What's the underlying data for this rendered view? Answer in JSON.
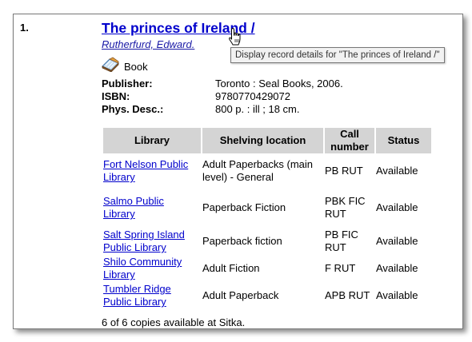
{
  "record": {
    "number": "1.",
    "title": "The princes of Ireland /",
    "author": "Rutherfurd, Edward.",
    "tooltip": "Display record details for \"The princes of Ireland /\"",
    "format_icon": "book-icon",
    "format": "Book",
    "details": [
      {
        "label": "Publisher:",
        "value": "Toronto : Seal Books, 2006."
      },
      {
        "label": "ISBN:",
        "value": "9780770429072"
      },
      {
        "label": "Phys. Desc.:",
        "value": "800 p. : ill ; 18 cm."
      }
    ]
  },
  "holdings": {
    "columns": [
      "Library",
      "Shelving location",
      "Call number",
      "Status"
    ],
    "rows": [
      {
        "library": "Fort Nelson Public Library",
        "location": "Adult Paperbacks (main level) - General",
        "call_number": "PB RUT",
        "status": "Available"
      },
      {
        "library": "Salmo Public Library",
        "location": "Paperback Fiction",
        "call_number": "PBK FIC RUT",
        "status": "Available"
      },
      {
        "library": "Salt Spring Island Public Library",
        "location": "Paperback fiction",
        "call_number": "PB FIC RUT",
        "status": "Available"
      },
      {
        "library": "Shilo Community Library",
        "location": "Adult Fiction",
        "call_number": "F RUT",
        "status": "Available"
      },
      {
        "library": "Tumbler Ridge Public Library",
        "location": "Adult Paperback",
        "call_number": "APB RUT",
        "status": "Available"
      }
    ],
    "summary": "6 of 6 copies available at Sitka."
  },
  "colors": {
    "link": "#0000cc",
    "header_bg": "#d4d4d4",
    "tooltip_bg": "#f2f2f2"
  }
}
